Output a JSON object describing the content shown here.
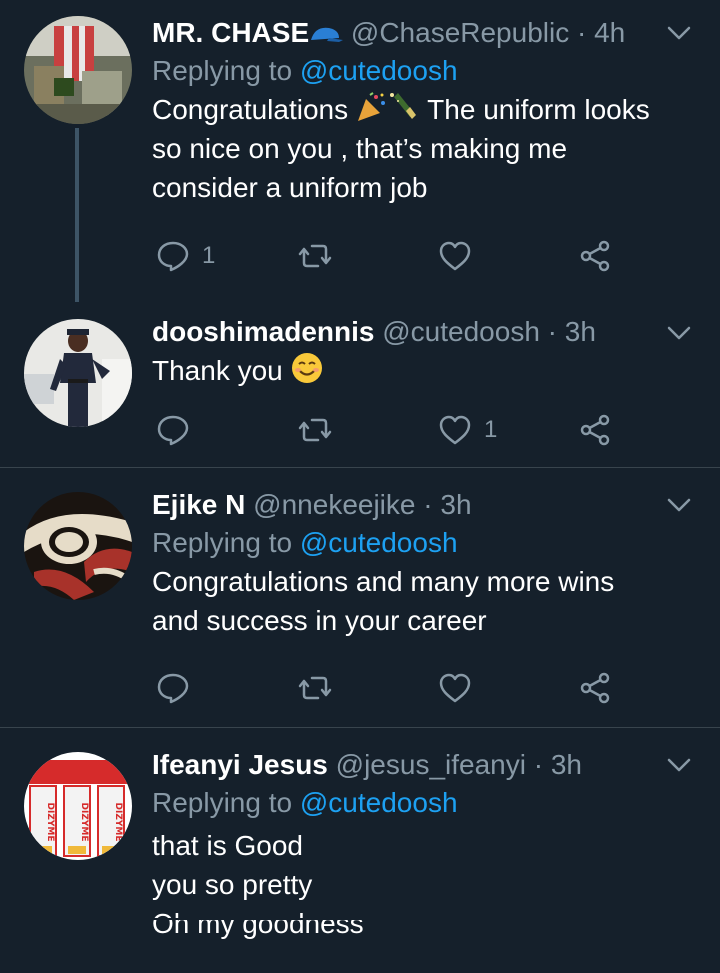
{
  "colors": {
    "background": "#15202b",
    "name": "#ffffff",
    "secondary": "#8899a6",
    "link": "#1da1f2",
    "divider": "#38444d",
    "thread_line": "#3d5466"
  },
  "tweets": [
    {
      "name": "MR. CHASE",
      "name_emoji": "blue-cap-emoji",
      "handle": "@ChaseRepublic",
      "separator": "·",
      "time": "4h",
      "replying_prefix": "Replying to ",
      "replying_to": "@cutedoosh",
      "text_part1": "Congratulations ",
      "text_emojis": [
        "party-popper-emoji",
        "champagne-emoji"
      ],
      "text_part2": " The uniform looks\nso nice on you , that’s making me\nconsider a uniform job",
      "replies": "1",
      "retweets": "",
      "likes": ""
    },
    {
      "name": "dooshimadennis",
      "handle": "@cutedoosh",
      "separator": "·",
      "time": "3h",
      "text": "Thank you",
      "text_emoji": "smiling-face-emoji",
      "replies": "",
      "retweets": "",
      "likes": "1"
    },
    {
      "name": "Ejike N",
      "handle": "@nnekeejike",
      "separator": "·",
      "time": "3h",
      "replying_prefix": "Replying to ",
      "replying_to": "@cutedoosh",
      "text": "Congratulations and many more wins\nand success in your career",
      "replies": "",
      "retweets": "",
      "likes": ""
    },
    {
      "name": "Ifeanyi Jesus",
      "handle": "@jesus_ifeanyi",
      "separator": "·",
      "time": "3h",
      "replying_prefix": "Replying to ",
      "replying_to": "@cutedoosh",
      "text": "that is Good\nyou so pretty\nOh my goodness",
      "avatar_text": "DIZYME"
    }
  ]
}
